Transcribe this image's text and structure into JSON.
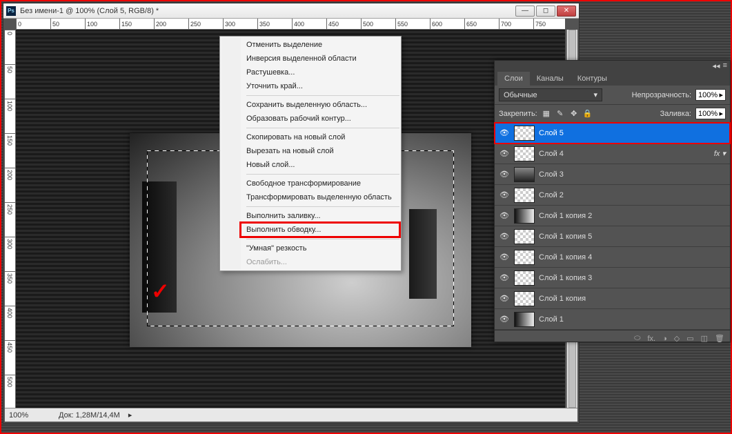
{
  "window": {
    "title": "Без имени-1 @ 100% (Слой 5, RGB/8) *",
    "ps_label": "Ps"
  },
  "ruler_h": [
    "0",
    "50",
    "100",
    "150",
    "200",
    "250",
    "300",
    "350",
    "400",
    "450",
    "500",
    "550",
    "600",
    "650",
    "700",
    "750"
  ],
  "ruler_v": [
    "0",
    "50",
    "100",
    "150",
    "200",
    "250",
    "300",
    "350",
    "400",
    "450",
    "500"
  ],
  "statusbar": {
    "zoom": "100%",
    "doc_info": "Док: 1,28M/14,4M"
  },
  "context_menu": {
    "groups": [
      [
        {
          "label": "Отменить выделение",
          "disabled": false
        },
        {
          "label": "Инверсия выделенной области",
          "disabled": false
        },
        {
          "label": "Растушевка...",
          "disabled": false
        },
        {
          "label": "Уточнить край...",
          "disabled": false
        }
      ],
      [
        {
          "label": "Сохранить выделенную область...",
          "disabled": false
        },
        {
          "label": "Образовать рабочий контур...",
          "disabled": false
        }
      ],
      [
        {
          "label": "Скопировать на новый слой",
          "disabled": false
        },
        {
          "label": "Вырезать на новый слой",
          "disabled": false
        },
        {
          "label": "Новый слой...",
          "disabled": false
        }
      ],
      [
        {
          "label": "Свободное трансформирование",
          "disabled": false
        },
        {
          "label": "Трансформировать выделенную область",
          "disabled": false
        }
      ],
      [
        {
          "label": "Выполнить заливку...",
          "disabled": false
        },
        {
          "label": "Выполнить обводку...",
          "disabled": false,
          "highlight": true
        }
      ],
      [
        {
          "label": "\"Умная\" резкость",
          "disabled": false
        },
        {
          "label": "Ослабить...",
          "disabled": true
        }
      ]
    ]
  },
  "layers_panel": {
    "tabs": [
      "Слои",
      "Каналы",
      "Контуры"
    ],
    "active_tab": 0,
    "blend_mode": "Обычные",
    "opacity_label": "Непрозрачность:",
    "opacity_value": "100%",
    "lock_label": "Закрепить:",
    "fill_label": "Заливка:",
    "fill_value": "100%",
    "lock_icons": [
      "▦",
      "✎",
      "✥",
      "🔒"
    ],
    "layers": [
      {
        "name": "Слой 5",
        "selected": true,
        "thumb": "checker",
        "fx": false
      },
      {
        "name": "Слой 4",
        "selected": false,
        "thumb": "checker",
        "fx": true
      },
      {
        "name": "Слой 3",
        "selected": false,
        "thumb": "img",
        "fx": false
      },
      {
        "name": "Слой 2",
        "selected": false,
        "thumb": "checker",
        "fx": false
      },
      {
        "name": "Слой 1 копия 2",
        "selected": false,
        "thumb": "grad",
        "fx": false
      },
      {
        "name": "Слой 1 копия 5",
        "selected": false,
        "thumb": "checker",
        "fx": false
      },
      {
        "name": "Слой 1 копия 4",
        "selected": false,
        "thumb": "checker",
        "fx": false
      },
      {
        "name": "Слой 1 копия 3",
        "selected": false,
        "thumb": "checker",
        "fx": false
      },
      {
        "name": "Слой 1 копия",
        "selected": false,
        "thumb": "checker",
        "fx": false
      },
      {
        "name": "Слой 1",
        "selected": false,
        "thumb": "grad",
        "fx": false
      }
    ],
    "bottom_icons": [
      "⬭",
      "fx.",
      "◑",
      "◇",
      "▭",
      "◫",
      "🗑"
    ]
  },
  "canvas": {
    "checkmark": "✓"
  }
}
